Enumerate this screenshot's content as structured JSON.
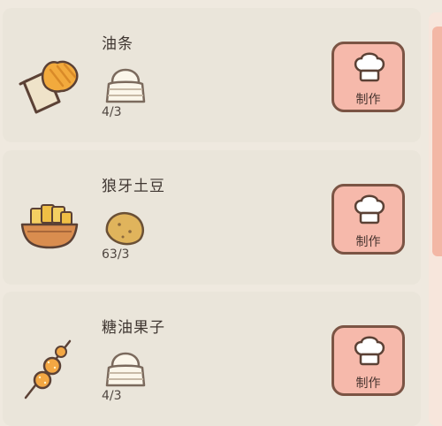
{
  "recipes": [
    {
      "name": "油条",
      "food_icon": "youtiao-icon",
      "ingredient_icon": "flour-bag-icon",
      "count": "4/3",
      "button_label": "制作",
      "button_icon": "chef-hat-icon"
    },
    {
      "name": "狼牙土豆",
      "food_icon": "wolf-tooth-potato-icon",
      "ingredient_icon": "potato-icon",
      "count": "63/3",
      "button_label": "制作",
      "button_icon": "chef-hat-icon"
    },
    {
      "name": "糖油果子",
      "food_icon": "sugar-oil-ball-skewer-icon",
      "ingredient_icon": "flour-bag-icon",
      "count": "4/3",
      "button_label": "制作",
      "button_icon": "chef-hat-icon"
    }
  ],
  "colors": {
    "card": "#eae5da",
    "background": "#efe9df",
    "button": "#f6b9ab",
    "button_border": "#7b5444",
    "scrollbar": "#f3b7a5"
  }
}
